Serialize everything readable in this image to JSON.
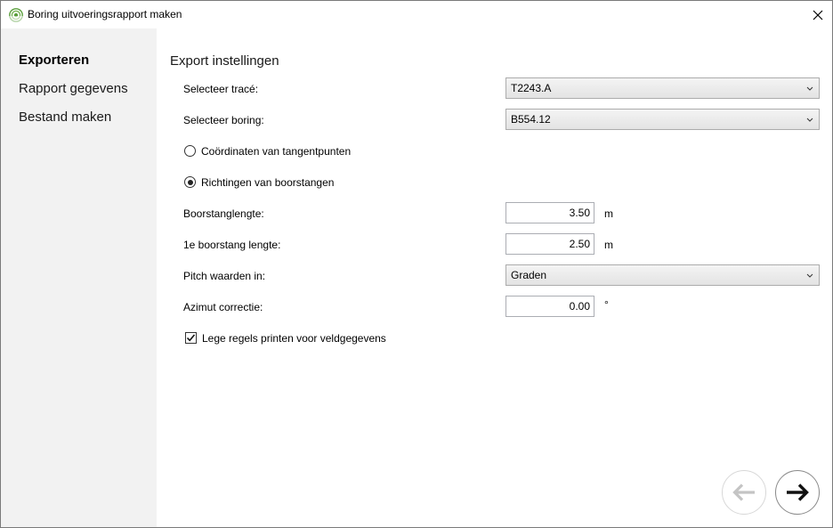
{
  "window": {
    "title": "Boring uitvoeringsrapport maken"
  },
  "sidebar": {
    "items": [
      {
        "label": "Exporteren",
        "active": true
      },
      {
        "label": "Rapport gegevens",
        "active": false
      },
      {
        "label": "Bestand maken",
        "active": false
      }
    ]
  },
  "main": {
    "section_title": "Export instellingen",
    "trace": {
      "label": "Selecteer tracé:",
      "value": "T2243.A"
    },
    "boring": {
      "label": "Selecteer boring:",
      "value": "B554.12"
    },
    "radio_coords": {
      "label": "Coördinaten van tangentpunten",
      "checked": false
    },
    "radio_directions": {
      "label": "Richtingen van boorstangen",
      "checked": true
    },
    "rod_length": {
      "label": "Boorstanglengte:",
      "value": "3.50",
      "unit": "m"
    },
    "first_rod_length": {
      "label": "1e boorstang lengte:",
      "value": "2.50",
      "unit": "m"
    },
    "pitch_unit": {
      "label": "Pitch waarden in:",
      "value": "Graden"
    },
    "azimuth": {
      "label": "Azimut correctie:",
      "value": "0.00",
      "unit": "°"
    },
    "empty_rows": {
      "label": "Lege regels printen voor veldgegevens",
      "checked": true
    }
  },
  "icons": {
    "app": "boring-app-icon",
    "close": "close-icon",
    "chevron": "chevron-down-icon",
    "back": "arrow-left-icon",
    "next": "arrow-right-icon"
  }
}
